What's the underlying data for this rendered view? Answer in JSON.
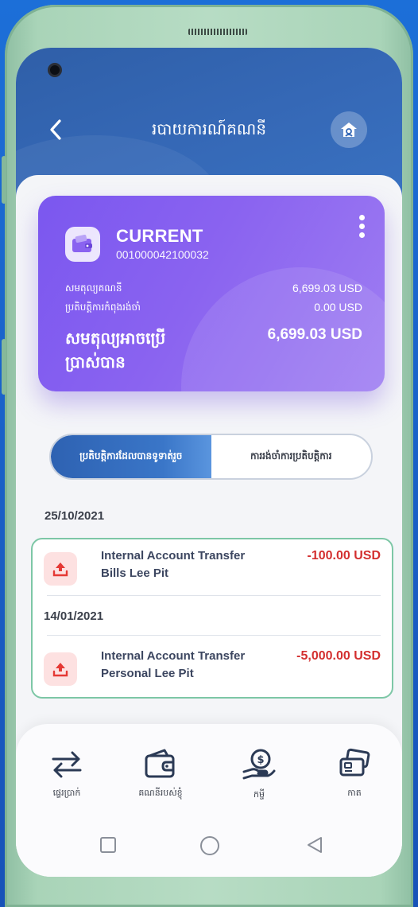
{
  "header": {
    "title": "របាយការណ៍គណនី",
    "back_icon": "chevron-left-icon",
    "home_icon": "home-icon"
  },
  "account_card": {
    "type": "CURRENT",
    "number": "001000042100032",
    "rows": [
      {
        "label": "សមតុល្យគណនី",
        "value": "6,699.03 USD"
      },
      {
        "label": "ប្រតិបត្តិការកំពុងរង់ចាំ",
        "value": "0.00 USD"
      }
    ],
    "available_label": "សមតុល្យអាចប្រើប្រាស់បាន",
    "available_value": "6,699.03 USD",
    "accent": "#8a63f0"
  },
  "tabs": {
    "completed": "ប្រតិបត្តិការដែលបានទូទាត់រួច",
    "pending": "ការរង់ចាំការប្រតិបត្តិការ"
  },
  "transactions": {
    "group_date": "25/10/2021",
    "items": [
      {
        "date": "25/10/2021",
        "title": "Internal Account Transfer",
        "subtitle": "Bills Lee Pit",
        "amount": "-100.00 USD"
      },
      {
        "date": "14/01/2021",
        "title": "Internal Account Transfer",
        "subtitle": "Personal Lee Pit",
        "amount": "-5,000.00 USD"
      }
    ],
    "amount_color": "#d32f2f"
  },
  "bottom_nav": [
    {
      "label": "ផ្ទេរប្រាក់",
      "icon": "transfer-arrows-icon"
    },
    {
      "label": "គណនីរបស់ខ្ញុំ",
      "icon": "wallet-icon"
    },
    {
      "label": "កម្ចី",
      "icon": "loan-coin-hand-icon"
    },
    {
      "label": "កាត",
      "icon": "cards-icon"
    }
  ]
}
